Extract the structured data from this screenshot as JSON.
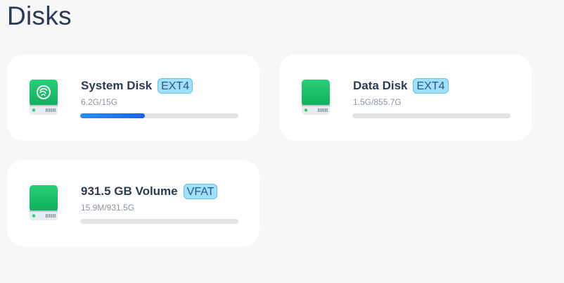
{
  "page": {
    "title": "Disks"
  },
  "disks": [
    {
      "name": "System Disk",
      "filesystem": "EXT4",
      "usage": "6.2G/15G",
      "used_fraction": 0.41,
      "icon": "deepin-logo-disk-icon"
    },
    {
      "name": "Data Disk",
      "filesystem": "EXT4",
      "usage": "1.5G/855.7G",
      "used_fraction": 0.0018,
      "icon": "disk-icon"
    },
    {
      "name": "931.5 GB Volume",
      "filesystem": "VFAT",
      "usage": "15.9M/931.5G",
      "used_fraction": 2e-05,
      "icon": "disk-icon"
    }
  ],
  "colors": {
    "disk_green": "#1ec46e",
    "progress_blue": "#1a73ea",
    "badge_bg": "#9fe0fb"
  }
}
